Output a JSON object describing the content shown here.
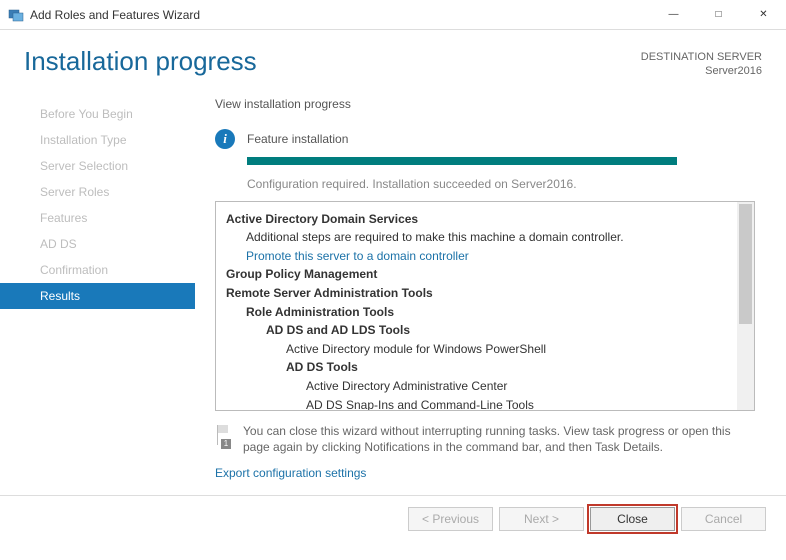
{
  "window": {
    "title": "Add Roles and Features Wizard"
  },
  "header": {
    "page_title": "Installation progress",
    "dest_label": "DESTINATION SERVER",
    "dest_value": "Server2016"
  },
  "sidebar": {
    "items": [
      {
        "label": "Before You Begin",
        "active": false
      },
      {
        "label": "Installation Type",
        "active": false
      },
      {
        "label": "Server Selection",
        "active": false
      },
      {
        "label": "Server Roles",
        "active": false
      },
      {
        "label": "Features",
        "active": false
      },
      {
        "label": "AD DS",
        "active": false
      },
      {
        "label": "Confirmation",
        "active": false
      },
      {
        "label": "Results",
        "active": true
      }
    ]
  },
  "main": {
    "heading": "View installation progress",
    "status_text": "Feature installation",
    "config_msg": "Configuration required. Installation succeeded on Server2016.",
    "results": {
      "line0": "Active Directory Domain Services",
      "line1": "Additional steps are required to make this machine a domain controller.",
      "link1": "Promote this server to a domain controller",
      "line2": "Group Policy Management",
      "line3": "Remote Server Administration Tools",
      "line4": "Role Administration Tools",
      "line5": "AD DS and AD LDS Tools",
      "line6": "Active Directory module for Windows PowerShell",
      "line7": "AD DS Tools",
      "line8": "Active Directory Administrative Center",
      "line9": "AD DS Snap-Ins and Command-Line Tools"
    },
    "note": "You can close this wizard without interrupting running tasks. View task progress or open this page again by clicking Notifications in the command bar, and then Task Details.",
    "export_link": "Export configuration settings"
  },
  "footer": {
    "previous": "< Previous",
    "next": "Next >",
    "close": "Close",
    "cancel": "Cancel"
  }
}
